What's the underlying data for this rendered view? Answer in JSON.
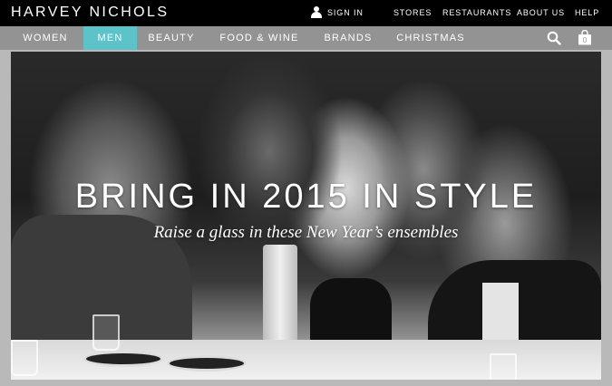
{
  "brand": {
    "logo_text": "HARVEY NICHOLS"
  },
  "topbar": {
    "sign_in": "SIGN IN",
    "links": [
      "STORES",
      "RESTAURANTS",
      "ABOUT US",
      "HELP"
    ]
  },
  "mainnav": {
    "items": [
      "WOMEN",
      "MEN",
      "BEAUTY",
      "FOOD & WINE",
      "BRANDS",
      "CHRISTMAS"
    ],
    "active": "MEN"
  },
  "icons": {
    "user": "user-icon",
    "search": "search-icon",
    "bag": "shopping-bag-icon",
    "bag_count": "0"
  },
  "hero": {
    "headline": "BRING IN 2015 IN STYLE",
    "subline": "Raise a glass in these New Year’s ensembles"
  },
  "colors": {
    "topbar_bg": "#000000",
    "nav_bg": "#939393",
    "active_tab": "#5cc3c8",
    "page_bg": "#b9b9b9"
  }
}
